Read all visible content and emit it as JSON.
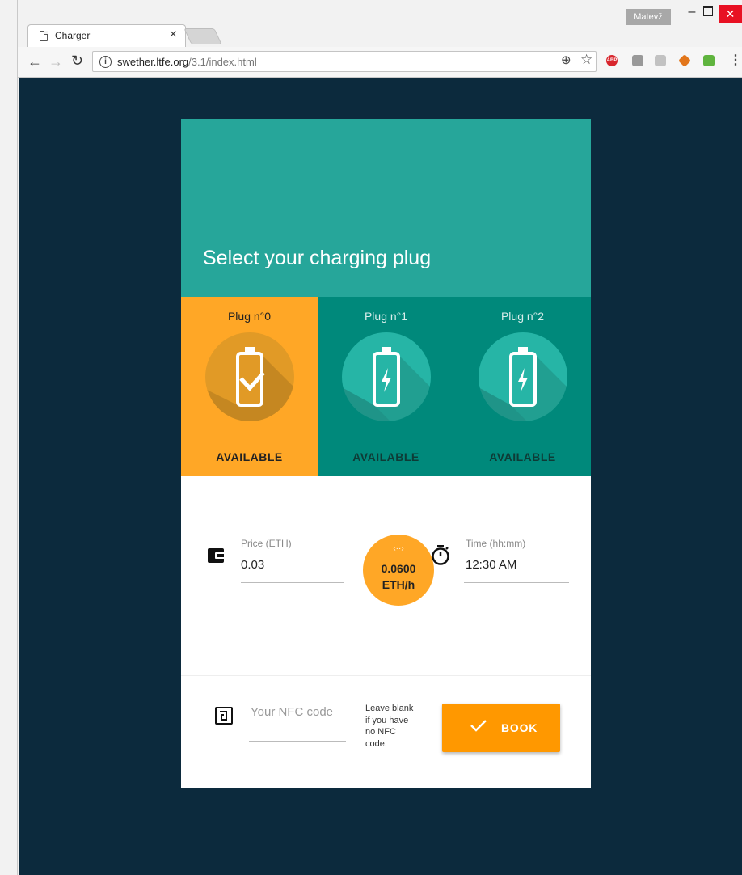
{
  "browser": {
    "tab_title": "Charger",
    "tab_close": "×",
    "profile_name": "Matevž",
    "url_host": "swether.ltfe.org",
    "url_path": "/3.1/index.html",
    "extensions": [
      "abp-icon",
      "extension-icon",
      "pdf-icon",
      "metamask-icon",
      "print-icon"
    ]
  },
  "app": {
    "heading": "Select your charging plug",
    "plugs": [
      {
        "title": "Plug n°0",
        "status": "AVAILABLE",
        "selected": true
      },
      {
        "title": "Plug n°1",
        "status": "AVAILABLE",
        "selected": false
      },
      {
        "title": "Plug n°2",
        "status": "AVAILABLE",
        "selected": false
      }
    ],
    "price": {
      "label": "Price (ETH)",
      "value": "0.03"
    },
    "rate": {
      "arrows": "‹··›",
      "value": "0.0600",
      "unit": "ETH/h"
    },
    "time": {
      "label": "Time (hh:mm)",
      "value": "12:30 AM"
    },
    "nfc": {
      "placeholder": "Your NFC code",
      "help": "Leave blank if you have no NFC code."
    },
    "book_label": "BOOK"
  },
  "colors": {
    "background": "#0c2a3d",
    "hero": "#26a69a",
    "plug": "#00897b",
    "plug_selected": "#ffa726",
    "accent": "#ff9800"
  }
}
